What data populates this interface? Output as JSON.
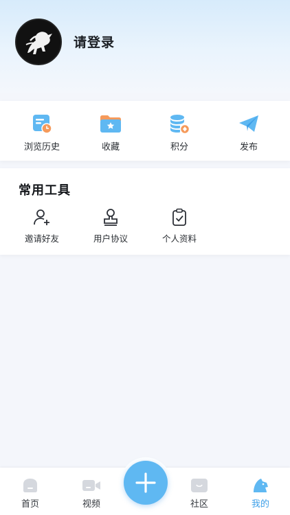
{
  "profile": {
    "login_label": "请登录"
  },
  "quick_actions": [
    {
      "label": "浏览历史",
      "icon": "history-icon"
    },
    {
      "label": "收藏",
      "icon": "favorites-folder-icon"
    },
    {
      "label": "积分",
      "icon": "points-coins-icon"
    },
    {
      "label": "发布",
      "icon": "paper-plane-icon"
    }
  ],
  "tools": {
    "title": "常用工具",
    "items": [
      {
        "label": "邀请好友",
        "icon": "add-user-icon"
      },
      {
        "label": "用户协议",
        "icon": "stamp-icon"
      },
      {
        "label": "个人资料",
        "icon": "clipboard-check-icon"
      }
    ]
  },
  "tabbar": {
    "items": [
      {
        "label": "首页",
        "icon": "home-icon"
      },
      {
        "label": "视频",
        "icon": "video-icon"
      },
      {
        "label": "社区",
        "icon": "community-icon"
      },
      {
        "label": "我的",
        "icon": "mine-icon",
        "active": true
      }
    ],
    "center_action_icon": "plus-icon"
  },
  "colors": {
    "accent": "#5fb8f2",
    "active_tab": "#3d9fe8",
    "orange": "#f59a5b"
  }
}
